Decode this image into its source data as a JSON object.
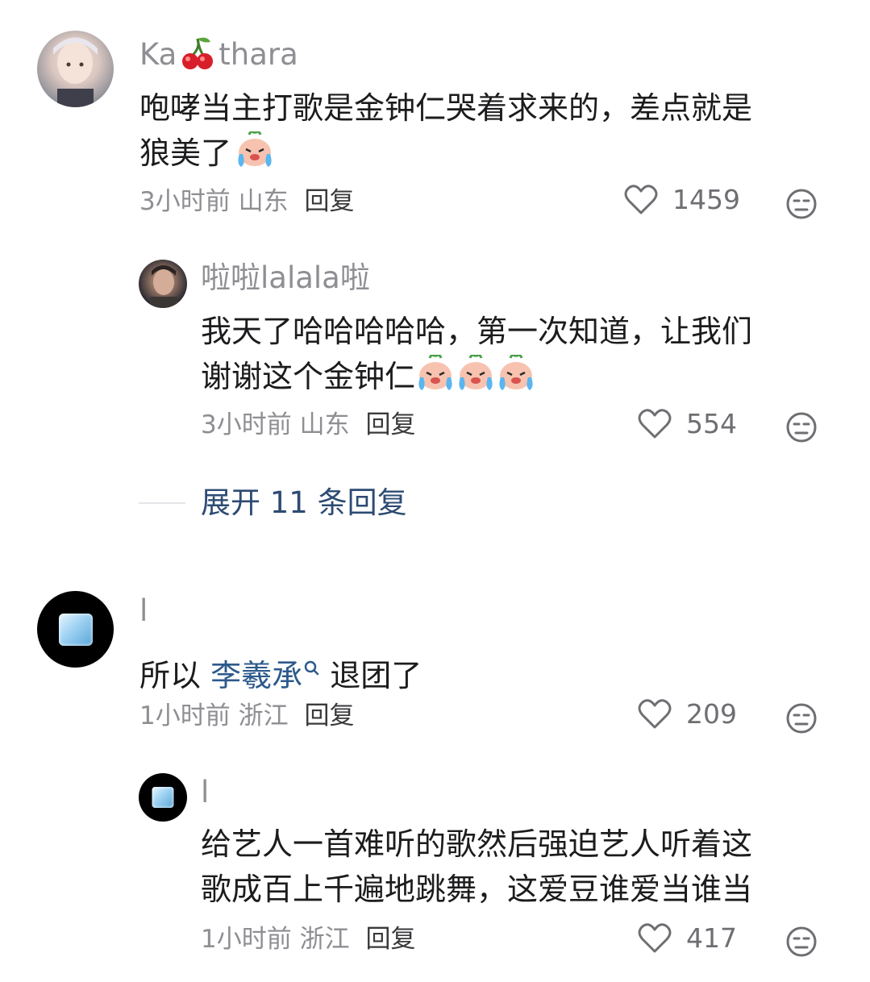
{
  "comments": [
    {
      "username_a": "Ka",
      "username_b": "thara",
      "text_l1": "咆哮当主打歌是金钟仁哭着求来的，差点就是",
      "text_l2": "狼美了",
      "time": "3小时前",
      "location": "山东",
      "reply": "回复",
      "likes": "1459",
      "reply_item": {
        "username": "啦啦lalala啦",
        "text_l1": "我天了哈哈哈哈哈，第一次知道，让我们",
        "text_l2": "谢谢这个金钟仁",
        "time": "3小时前",
        "location": "山东",
        "reply": "回复",
        "likes": "554"
      },
      "expand": "展开 11 条回复"
    },
    {
      "username": "l",
      "text_prefix": "所以",
      "text_link": "李羲承",
      "text_suffix": "退团了",
      "time": "1小时前",
      "location": "浙江",
      "reply": "回复",
      "likes": "209",
      "reply_item": {
        "username": "l",
        "text_l1": "给艺人一首难听的歌然后强迫艺人听着这",
        "text_l2": "歌成百上千遍地跳舞，这爱豆谁爱当谁当",
        "time": "1小时前",
        "location": "浙江",
        "reply": "回复",
        "likes": "417"
      }
    }
  ],
  "colors": {
    "link": "#2d5a8c",
    "meta": "#8e8e93",
    "text": "#1c1c1e"
  },
  "icons": [
    "heart-icon",
    "dislike-face-icon",
    "search-icon",
    "cherry-icon",
    "crying-emoji-icon"
  ]
}
